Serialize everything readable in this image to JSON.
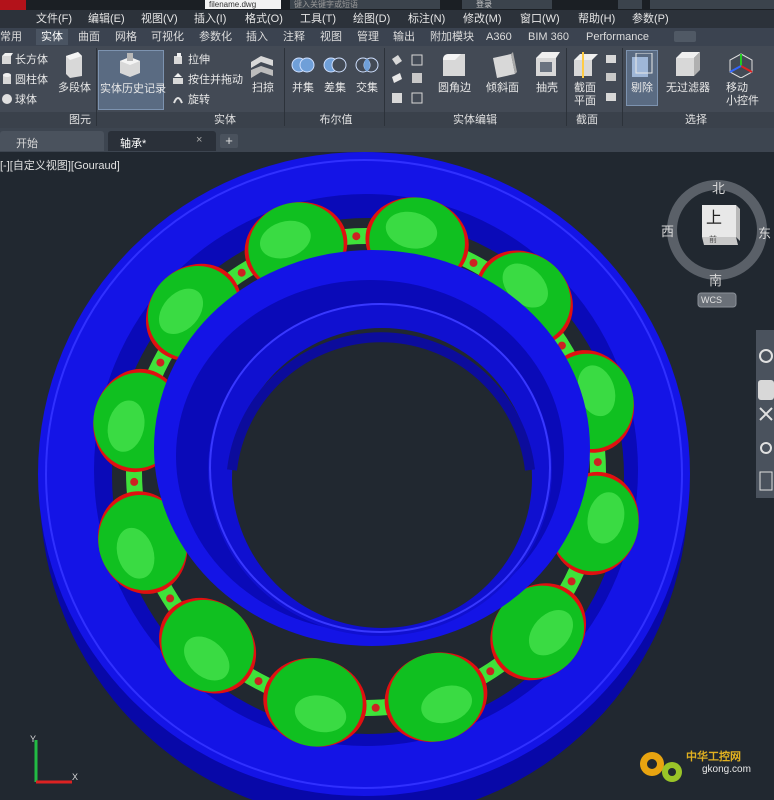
{
  "window": {
    "document_tab": "filename.dwg",
    "search_placeholder": "键入关键字或短语",
    "user_label": "登录"
  },
  "menubar": {
    "items": [
      "文件(F)",
      "编辑(E)",
      "视图(V)",
      "插入(I)",
      "格式(O)",
      "工具(T)",
      "绘图(D)",
      "标注(N)",
      "修改(M)",
      "窗口(W)",
      "帮助(H)",
      "参数(P)"
    ]
  },
  "ribbon_tabs": {
    "items": [
      "常用",
      "实体",
      "曲面",
      "网格",
      "可视化",
      "参数化",
      "插入",
      "注释",
      "视图",
      "管理",
      "输出",
      "附加模块",
      "A360",
      "BIM 360",
      "Performance"
    ],
    "active": "实体"
  },
  "ribbon": {
    "primitive": {
      "box": "长方体",
      "cylinder": "圆柱体",
      "sphere": "球体",
      "polysolid": "多段体",
      "panel": "图元"
    },
    "solid": {
      "history": "实体历史记录",
      "extrude": "拉伸",
      "presspull": "按住并拖动",
      "revolve": "旋转",
      "sweep": "扫掠",
      "panel": "实体"
    },
    "boolean": {
      "union": "并集",
      "subtract": "差集",
      "intersect": "交集",
      "panel": "布尔值"
    },
    "solid_edit": {
      "fillet": "圆角边",
      "taper": "倾斜面",
      "shell": "抽壳",
      "panel": "实体编辑"
    },
    "section": {
      "plane": "截面\n平面",
      "panel": "截面"
    },
    "cull": {
      "label": "剔除"
    },
    "selection": {
      "filter": "无过滤器",
      "gizmo": "移动\n小控件",
      "panel": "选择"
    }
  },
  "doc_tabs": {
    "start": "开始",
    "current": "轴承*"
  },
  "viewport": {
    "label": "[-][自定义视图][Gouraud]",
    "viewcube": {
      "top": "上",
      "north": "北",
      "south": "南",
      "east": "东",
      "west": "西",
      "front_hint": "前",
      "wcs": "WCS"
    },
    "ucs": {
      "x": "X",
      "y": "Y"
    }
  },
  "watermark": {
    "cn": "中华工控网",
    "url": "gkong.com"
  },
  "colors": {
    "ring": "#1010e0",
    "ring_dark": "#0a0ab0",
    "ball": "#10c020",
    "ball_edge": "#e01010",
    "cage": "#40e020",
    "background": "#212830"
  },
  "model": {
    "ball_count": 12
  }
}
